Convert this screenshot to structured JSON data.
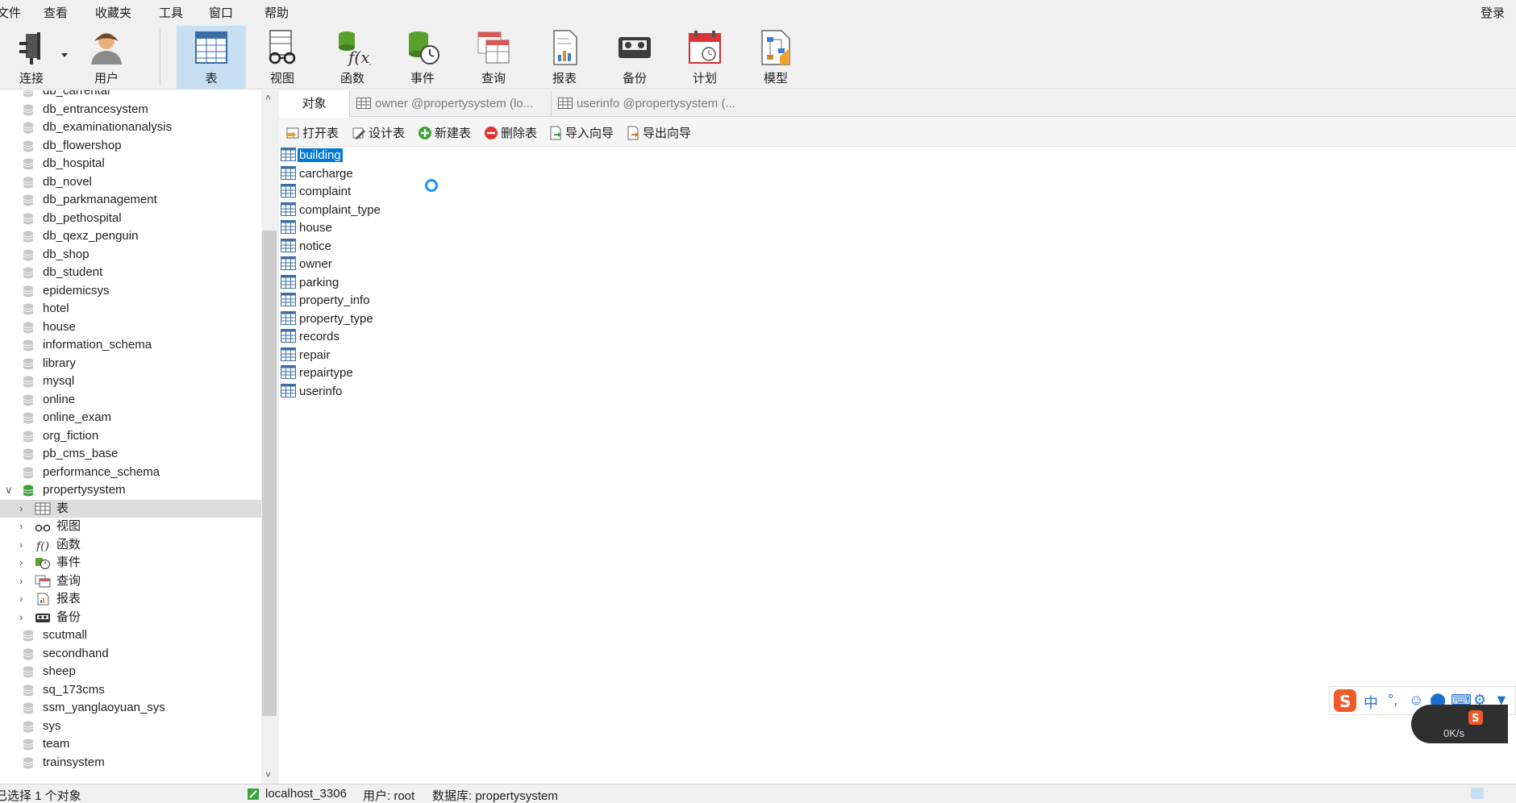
{
  "menu": {
    "items": [
      "文件",
      "查看",
      "收藏夹",
      "工具",
      "窗口",
      "帮助"
    ],
    "login": "登录"
  },
  "toolbar": {
    "connect": "连接",
    "user": "用户",
    "table": "表",
    "view": "视图",
    "function": "函数",
    "event": "事件",
    "query": "查询",
    "report": "报表",
    "backup": "备份",
    "schedule": "计划",
    "model": "模型"
  },
  "sidebar": {
    "databases_before": [
      "db_carrental",
      "db_entrancesystem",
      "db_examinationanalysis",
      "db_flowershop",
      "db_hospital",
      "db_novel",
      "db_parkmanagement",
      "db_pethospital",
      "db_qexz_penguin",
      "db_shop",
      "db_student",
      "epidemicsys",
      "hotel",
      "house",
      "information_schema",
      "library",
      "mysql",
      "online",
      "online_exam",
      "org_fiction",
      "pb_cms_base",
      "performance_schema"
    ],
    "open_database": "propertysystem",
    "children": [
      "表",
      "视图",
      "函数",
      "事件",
      "查询",
      "报表",
      "备份"
    ],
    "databases_after": [
      "scutmall",
      "secondhand",
      "sheep",
      "sq_173cms",
      "ssm_yanglaoyuan_sys",
      "sys",
      "team",
      "trainsystem"
    ]
  },
  "tabs": {
    "objects": "对象",
    "tab1": "owner @propertysystem (lo...",
    "tab2": "userinfo @propertysystem (..."
  },
  "objbar": {
    "open": "打开表",
    "design": "设计表",
    "new": "新建表",
    "delete": "删除表",
    "import": "导入向导",
    "export": "导出向导"
  },
  "tables": [
    "building",
    "carcharge",
    "complaint",
    "complaint_type",
    "house",
    "notice",
    "owner",
    "parking",
    "property_info",
    "property_type",
    "records",
    "repair",
    "repairtype",
    "userinfo"
  ],
  "selected_table": "building",
  "ime": {
    "zh": "中"
  },
  "net": {
    "up": "0",
    "down": "0K/s"
  },
  "status": {
    "selection": "已选择 1 个对象",
    "connection": "localhost_3306",
    "user": "用户: root",
    "database": "数据库: propertysystem"
  },
  "colors": {
    "accent": "#0078d7",
    "toolbar_active": "#c7dff3",
    "db_icon": "#c8c8c8",
    "db_open_icon": "#3aa33a"
  }
}
